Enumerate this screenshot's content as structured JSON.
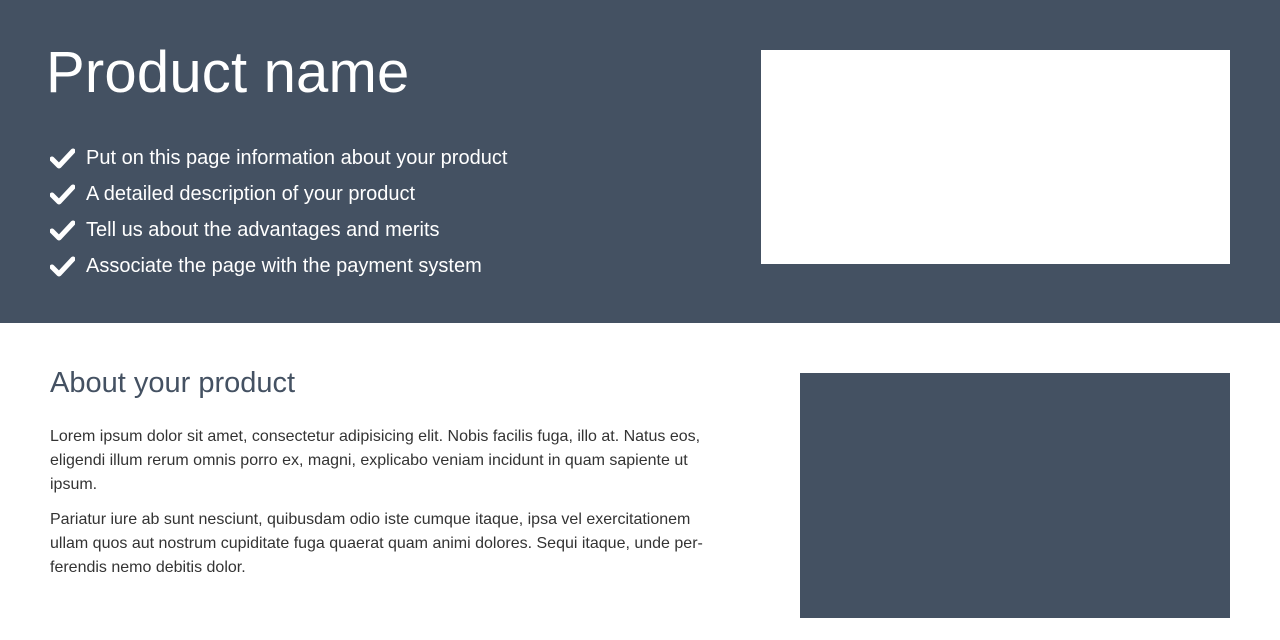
{
  "hero": {
    "title": "Product name",
    "features": [
      "Put on this page information about your product",
      "A detailed description of your product",
      "Tell us about the advantages and merits",
      "Associate the page with the payment system"
    ],
    "feature_icon": "check-icon",
    "background_color": "#445162"
  },
  "about": {
    "title": "About your product",
    "paragraphs": [
      "Lorem ipsum dolor sit amet, consectetur adipisicing elit. Nobis facilis fuga, illo at. Natus eos, eligendi illum rerum omnis porro ex, magni, explicabo veniam incidunt in quam sapiente ut ipsum.",
      "Pariatur iure ab sunt nesciunt, quibusdam odio iste cumque itaque, ipsa vel exercitationem ullam quos aut nostrum cupiditate fuga quaerat quam animi dolores. Sequi itaque, unde per-ferendis nemo debitis dolor."
    ],
    "title_color": "#445162",
    "text_color": "#333333"
  }
}
